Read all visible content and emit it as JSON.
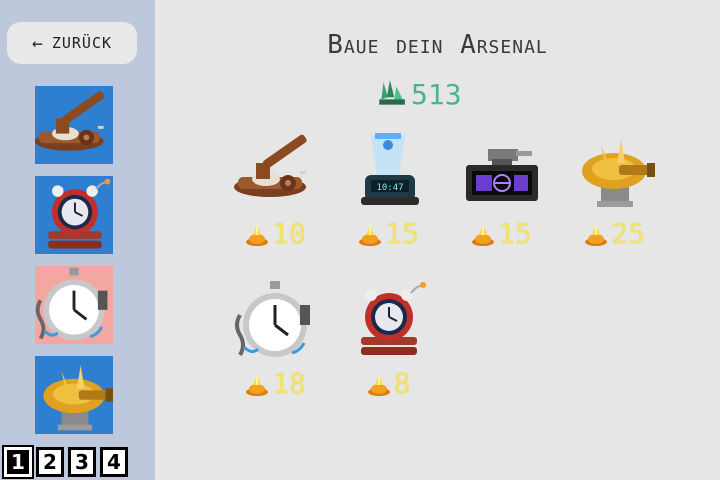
{
  "sidebar": {
    "back_arrow": "←",
    "back_label": "ZURÜCK",
    "slots": [
      {
        "icon": "cannon-icon",
        "bg": "#2f7fd0"
      },
      {
        "icon": "alarm-bomb-icon",
        "bg": "#2f7fd0"
      },
      {
        "icon": "chained-stopwatch-icon",
        "bg": "#f4a6a0"
      },
      {
        "icon": "golden-turret-icon",
        "bg": "#2f7fd0"
      }
    ],
    "pages": [
      "1",
      "2",
      "3",
      "4"
    ],
    "active_page": "1"
  },
  "main": {
    "title": "Baue dein Arsenal",
    "currency": {
      "icon": "crystal-icon",
      "value": "513",
      "color": "#4db38a"
    },
    "cost_icon": "flame-icon",
    "items": [
      {
        "icon": "cannon-icon",
        "cost": "10"
      },
      {
        "icon": "hologram-clock-icon",
        "cost": "15"
      },
      {
        "icon": "radar-console-icon",
        "cost": "15"
      },
      {
        "icon": "golden-turret-icon",
        "cost": "25"
      },
      {
        "icon": "frozen-stopwatch-icon",
        "cost": "18"
      },
      {
        "icon": "alarm-bomb-icon",
        "cost": "8"
      }
    ]
  }
}
